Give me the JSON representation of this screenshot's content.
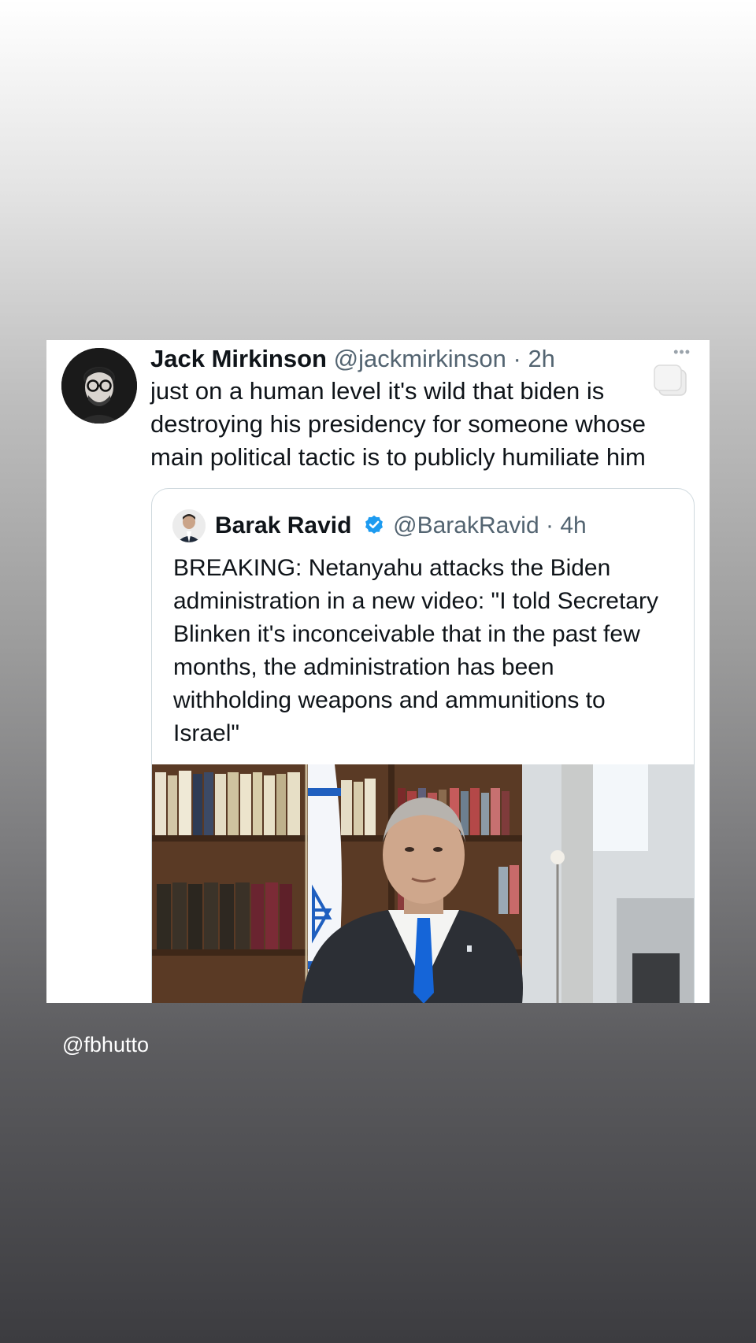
{
  "tweet": {
    "author_name": "Jack Mirkinson",
    "handle": "@jackmirkinson",
    "separator": "·",
    "time": "2h",
    "more_label": "•••",
    "text": "just on a human level it's wild that biden is destroying his presidency for someone whose main political tactic is to publicly humiliate him"
  },
  "quote": {
    "author_name": "Barak Ravid",
    "handle": "@BarakRavid",
    "separator": "·",
    "time": "4h",
    "verified_color": "#1d9bf0",
    "text": "BREAKING: Netanyahu attacks the Biden administration in a new video: \"I told Secretary Blinken it's inconceivable that in the past few months, the administration has been withholding weapons and ammunitions to Israel\""
  },
  "watermark": "@fbhutto",
  "colors": {
    "text_primary": "#0f1419",
    "text_secondary": "#536471",
    "quote_border": "#cfd9de",
    "flag_blue": "#1f5fbf",
    "tie_blue": "#1565d8"
  }
}
